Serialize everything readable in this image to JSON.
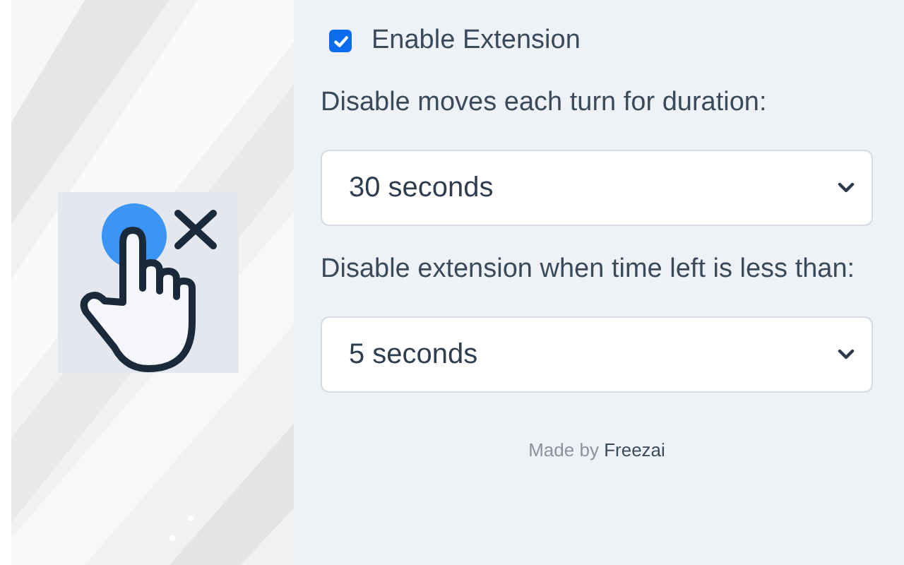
{
  "enable": {
    "label": "Enable Extension",
    "checked": true
  },
  "settings": [
    {
      "label": "Disable moves each turn for duration:",
      "value": "30 seconds"
    },
    {
      "label": "Disable extension when time left is less than:",
      "value": "5 seconds"
    }
  ],
  "footer": {
    "text": "Made by",
    "author": "Freezai"
  }
}
